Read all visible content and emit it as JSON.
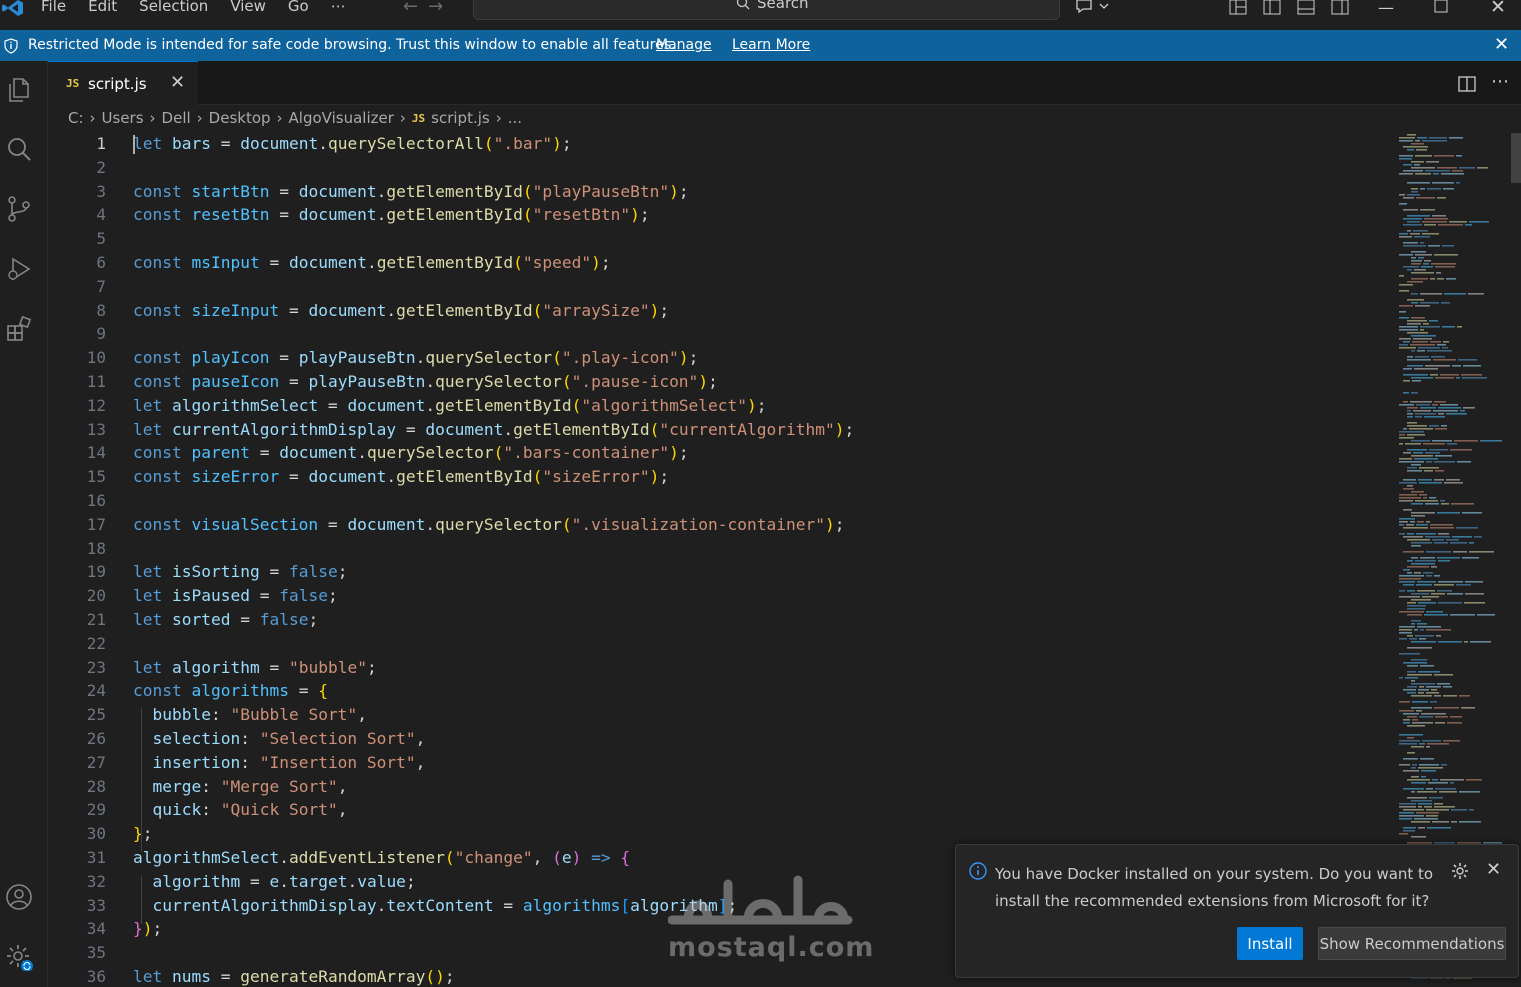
{
  "menu": [
    "File",
    "Edit",
    "Selection",
    "View",
    "Go",
    "⋯"
  ],
  "search": {
    "label": "Search"
  },
  "banner": {
    "message": "Restricted Mode is intended for safe code browsing. Trust this window to enable all features.",
    "manage": "Manage",
    "learn_more": "Learn More"
  },
  "tab": {
    "icon_label": "JS",
    "name": "script.js"
  },
  "breadcrumb": [
    "C:",
    "Users",
    "Dell",
    "Desktop",
    "AlgoVisualizer",
    "script.js",
    "..."
  ],
  "breadcrumb_icon": "JS",
  "active_line": 1,
  "code_lines": [
    [
      [
        "k",
        "let"
      ],
      [
        "o",
        " "
      ],
      [
        "v",
        "bars"
      ],
      [
        "o",
        " = "
      ],
      [
        "v",
        "document"
      ],
      [
        "o",
        "."
      ],
      [
        "f",
        "querySelectorAll"
      ],
      [
        "b1",
        "("
      ],
      [
        "s",
        "\".bar\""
      ],
      [
        "b1",
        ")"
      ],
      [
        "o",
        ";"
      ]
    ],
    [],
    [
      [
        "k",
        "const"
      ],
      [
        "o",
        " "
      ],
      [
        "c",
        "startBtn"
      ],
      [
        "o",
        " = "
      ],
      [
        "v",
        "document"
      ],
      [
        "o",
        "."
      ],
      [
        "f",
        "getElementById"
      ],
      [
        "b1",
        "("
      ],
      [
        "s",
        "\"playPauseBtn\""
      ],
      [
        "b1",
        ")"
      ],
      [
        "o",
        ";"
      ]
    ],
    [
      [
        "k",
        "const"
      ],
      [
        "o",
        " "
      ],
      [
        "c",
        "resetBtn"
      ],
      [
        "o",
        " = "
      ],
      [
        "v",
        "document"
      ],
      [
        "o",
        "."
      ],
      [
        "f",
        "getElementById"
      ],
      [
        "b1",
        "("
      ],
      [
        "s",
        "\"resetBtn\""
      ],
      [
        "b1",
        ")"
      ],
      [
        "o",
        ";"
      ]
    ],
    [],
    [
      [
        "k",
        "const"
      ],
      [
        "o",
        " "
      ],
      [
        "c",
        "msInput"
      ],
      [
        "o",
        " = "
      ],
      [
        "v",
        "document"
      ],
      [
        "o",
        "."
      ],
      [
        "f",
        "getElementById"
      ],
      [
        "b1",
        "("
      ],
      [
        "s",
        "\"speed\""
      ],
      [
        "b1",
        ")"
      ],
      [
        "o",
        ";"
      ]
    ],
    [],
    [
      [
        "k",
        "const"
      ],
      [
        "o",
        " "
      ],
      [
        "c",
        "sizeInput"
      ],
      [
        "o",
        " = "
      ],
      [
        "v",
        "document"
      ],
      [
        "o",
        "."
      ],
      [
        "f",
        "getElementById"
      ],
      [
        "b1",
        "("
      ],
      [
        "s",
        "\"arraySize\""
      ],
      [
        "b1",
        ")"
      ],
      [
        "o",
        ";"
      ]
    ],
    [],
    [
      [
        "k",
        "const"
      ],
      [
        "o",
        " "
      ],
      [
        "c",
        "playIcon"
      ],
      [
        "o",
        " = "
      ],
      [
        "v",
        "playPauseBtn"
      ],
      [
        "o",
        "."
      ],
      [
        "f",
        "querySelector"
      ],
      [
        "b1",
        "("
      ],
      [
        "s",
        "\".play-icon\""
      ],
      [
        "b1",
        ")"
      ],
      [
        "o",
        ";"
      ]
    ],
    [
      [
        "k",
        "const"
      ],
      [
        "o",
        " "
      ],
      [
        "c",
        "pauseIcon"
      ],
      [
        "o",
        " = "
      ],
      [
        "v",
        "playPauseBtn"
      ],
      [
        "o",
        "."
      ],
      [
        "f",
        "querySelector"
      ],
      [
        "b1",
        "("
      ],
      [
        "s",
        "\".pause-icon\""
      ],
      [
        "b1",
        ")"
      ],
      [
        "o",
        ";"
      ]
    ],
    [
      [
        "k",
        "let"
      ],
      [
        "o",
        " "
      ],
      [
        "v",
        "algorithmSelect"
      ],
      [
        "o",
        " = "
      ],
      [
        "v",
        "document"
      ],
      [
        "o",
        "."
      ],
      [
        "f",
        "getElementById"
      ],
      [
        "b1",
        "("
      ],
      [
        "s",
        "\"algorithmSelect\""
      ],
      [
        "b1",
        ")"
      ],
      [
        "o",
        ";"
      ]
    ],
    [
      [
        "k",
        "let"
      ],
      [
        "o",
        " "
      ],
      [
        "v",
        "currentAlgorithmDisplay"
      ],
      [
        "o",
        " = "
      ],
      [
        "v",
        "document"
      ],
      [
        "o",
        "."
      ],
      [
        "f",
        "getElementById"
      ],
      [
        "b1",
        "("
      ],
      [
        "s",
        "\"currentAlgorithm\""
      ],
      [
        "b1",
        ")"
      ],
      [
        "o",
        ";"
      ]
    ],
    [
      [
        "k",
        "const"
      ],
      [
        "o",
        " "
      ],
      [
        "c",
        "parent"
      ],
      [
        "o",
        " = "
      ],
      [
        "v",
        "document"
      ],
      [
        "o",
        "."
      ],
      [
        "f",
        "querySelector"
      ],
      [
        "b1",
        "("
      ],
      [
        "s",
        "\".bars-container\""
      ],
      [
        "b1",
        ")"
      ],
      [
        "o",
        ";"
      ]
    ],
    [
      [
        "k",
        "const"
      ],
      [
        "o",
        " "
      ],
      [
        "c",
        "sizeError"
      ],
      [
        "o",
        " = "
      ],
      [
        "v",
        "document"
      ],
      [
        "o",
        "."
      ],
      [
        "f",
        "getElementById"
      ],
      [
        "b1",
        "("
      ],
      [
        "s",
        "\"sizeError\""
      ],
      [
        "b1",
        ")"
      ],
      [
        "o",
        ";"
      ]
    ],
    [],
    [
      [
        "k",
        "const"
      ],
      [
        "o",
        " "
      ],
      [
        "c",
        "visualSection"
      ],
      [
        "o",
        " = "
      ],
      [
        "v",
        "document"
      ],
      [
        "o",
        "."
      ],
      [
        "f",
        "querySelector"
      ],
      [
        "b1",
        "("
      ],
      [
        "s",
        "\".visualization-container\""
      ],
      [
        "b1",
        ")"
      ],
      [
        "o",
        ";"
      ]
    ],
    [],
    [
      [
        "k",
        "let"
      ],
      [
        "o",
        " "
      ],
      [
        "v",
        "isSorting"
      ],
      [
        "o",
        " = "
      ],
      [
        "k",
        "false"
      ],
      [
        "o",
        ";"
      ]
    ],
    [
      [
        "k",
        "let"
      ],
      [
        "o",
        " "
      ],
      [
        "v",
        "isPaused"
      ],
      [
        "o",
        " = "
      ],
      [
        "k",
        "false"
      ],
      [
        "o",
        ";"
      ]
    ],
    [
      [
        "k",
        "let"
      ],
      [
        "o",
        " "
      ],
      [
        "v",
        "sorted"
      ],
      [
        "o",
        " = "
      ],
      [
        "k",
        "false"
      ],
      [
        "o",
        ";"
      ]
    ],
    [],
    [
      [
        "k",
        "let"
      ],
      [
        "o",
        " "
      ],
      [
        "v",
        "algorithm"
      ],
      [
        "o",
        " = "
      ],
      [
        "s",
        "\"bubble\""
      ],
      [
        "o",
        ";"
      ]
    ],
    [
      [
        "k",
        "const"
      ],
      [
        "o",
        " "
      ],
      [
        "c",
        "algorithms"
      ],
      [
        "o",
        " = "
      ],
      [
        "b1",
        "{"
      ]
    ],
    [
      [
        "o",
        "  "
      ],
      [
        "v",
        "bubble"
      ],
      [
        "o",
        ": "
      ],
      [
        "s",
        "\"Bubble Sort\""
      ],
      [
        "o",
        ","
      ]
    ],
    [
      [
        "o",
        "  "
      ],
      [
        "v",
        "selection"
      ],
      [
        "o",
        ": "
      ],
      [
        "s",
        "\"Selection Sort\""
      ],
      [
        "o",
        ","
      ]
    ],
    [
      [
        "o",
        "  "
      ],
      [
        "v",
        "insertion"
      ],
      [
        "o",
        ": "
      ],
      [
        "s",
        "\"Insertion Sort\""
      ],
      [
        "o",
        ","
      ]
    ],
    [
      [
        "o",
        "  "
      ],
      [
        "v",
        "merge"
      ],
      [
        "o",
        ": "
      ],
      [
        "s",
        "\"Merge Sort\""
      ],
      [
        "o",
        ","
      ]
    ],
    [
      [
        "o",
        "  "
      ],
      [
        "v",
        "quick"
      ],
      [
        "o",
        ": "
      ],
      [
        "s",
        "\"Quick Sort\""
      ],
      [
        "o",
        ","
      ]
    ],
    [
      [
        "b1",
        "}"
      ],
      [
        "o",
        ";"
      ]
    ],
    [
      [
        "v",
        "algorithmSelect"
      ],
      [
        "o",
        "."
      ],
      [
        "f",
        "addEventListener"
      ],
      [
        "b1",
        "("
      ],
      [
        "s",
        "\"change\""
      ],
      [
        "o",
        ", "
      ],
      [
        "b2",
        "("
      ],
      [
        "v",
        "e"
      ],
      [
        "b2",
        ")"
      ],
      [
        "o",
        " "
      ],
      [
        "k",
        "=>"
      ],
      [
        "o",
        " "
      ],
      [
        "b2",
        "{"
      ]
    ],
    [
      [
        "o",
        "  "
      ],
      [
        "v",
        "algorithm"
      ],
      [
        "o",
        " = "
      ],
      [
        "v",
        "e"
      ],
      [
        "o",
        "."
      ],
      [
        "v",
        "target"
      ],
      [
        "o",
        "."
      ],
      [
        "v",
        "value"
      ],
      [
        "o",
        ";"
      ]
    ],
    [
      [
        "o",
        "  "
      ],
      [
        "v",
        "currentAlgorithmDisplay"
      ],
      [
        "o",
        "."
      ],
      [
        "v",
        "textContent"
      ],
      [
        "o",
        " = "
      ],
      [
        "c",
        "algorithms"
      ],
      [
        "b3",
        "["
      ],
      [
        "v",
        "algorithm"
      ],
      [
        "b3",
        "]"
      ],
      [
        "o",
        ";"
      ]
    ],
    [
      [
        "b2",
        "}"
      ],
      [
        "b1",
        ")"
      ],
      [
        "o",
        ";"
      ]
    ],
    [],
    [
      [
        "k",
        "let"
      ],
      [
        "o",
        " "
      ],
      [
        "v",
        "nums"
      ],
      [
        "o",
        " = "
      ],
      [
        "f",
        "generateRandomArray"
      ],
      [
        "b1",
        "()"
      ],
      [
        "o",
        ";"
      ]
    ]
  ],
  "notification": {
    "message": "You have Docker installed on your system. Do you want to install the recommended extensions from Microsoft for it?",
    "install": "Install",
    "show_recommendations": "Show Recommendations"
  },
  "watermark": {
    "text": "mostaql.com"
  },
  "colors": {
    "accent": "#0078d4",
    "banner": "#0e639c",
    "keyword": "#569cd6",
    "string": "#ce9178",
    "function": "#dcdcaa",
    "variable": "#9cdcfe",
    "constant": "#4fc1ff"
  },
  "icons": [
    "vscode-logo-icon",
    "search-icon",
    "arrow-left-icon",
    "arrow-right-icon",
    "copilot-icon",
    "layout-icon",
    "shield-icon",
    "close-icon",
    "explorer-icon",
    "source-control-icon",
    "run-debug-icon",
    "extensions-icon",
    "account-icon",
    "settings-gear-icon",
    "split-editor-icon",
    "more-actions-icon",
    "info-icon"
  ]
}
